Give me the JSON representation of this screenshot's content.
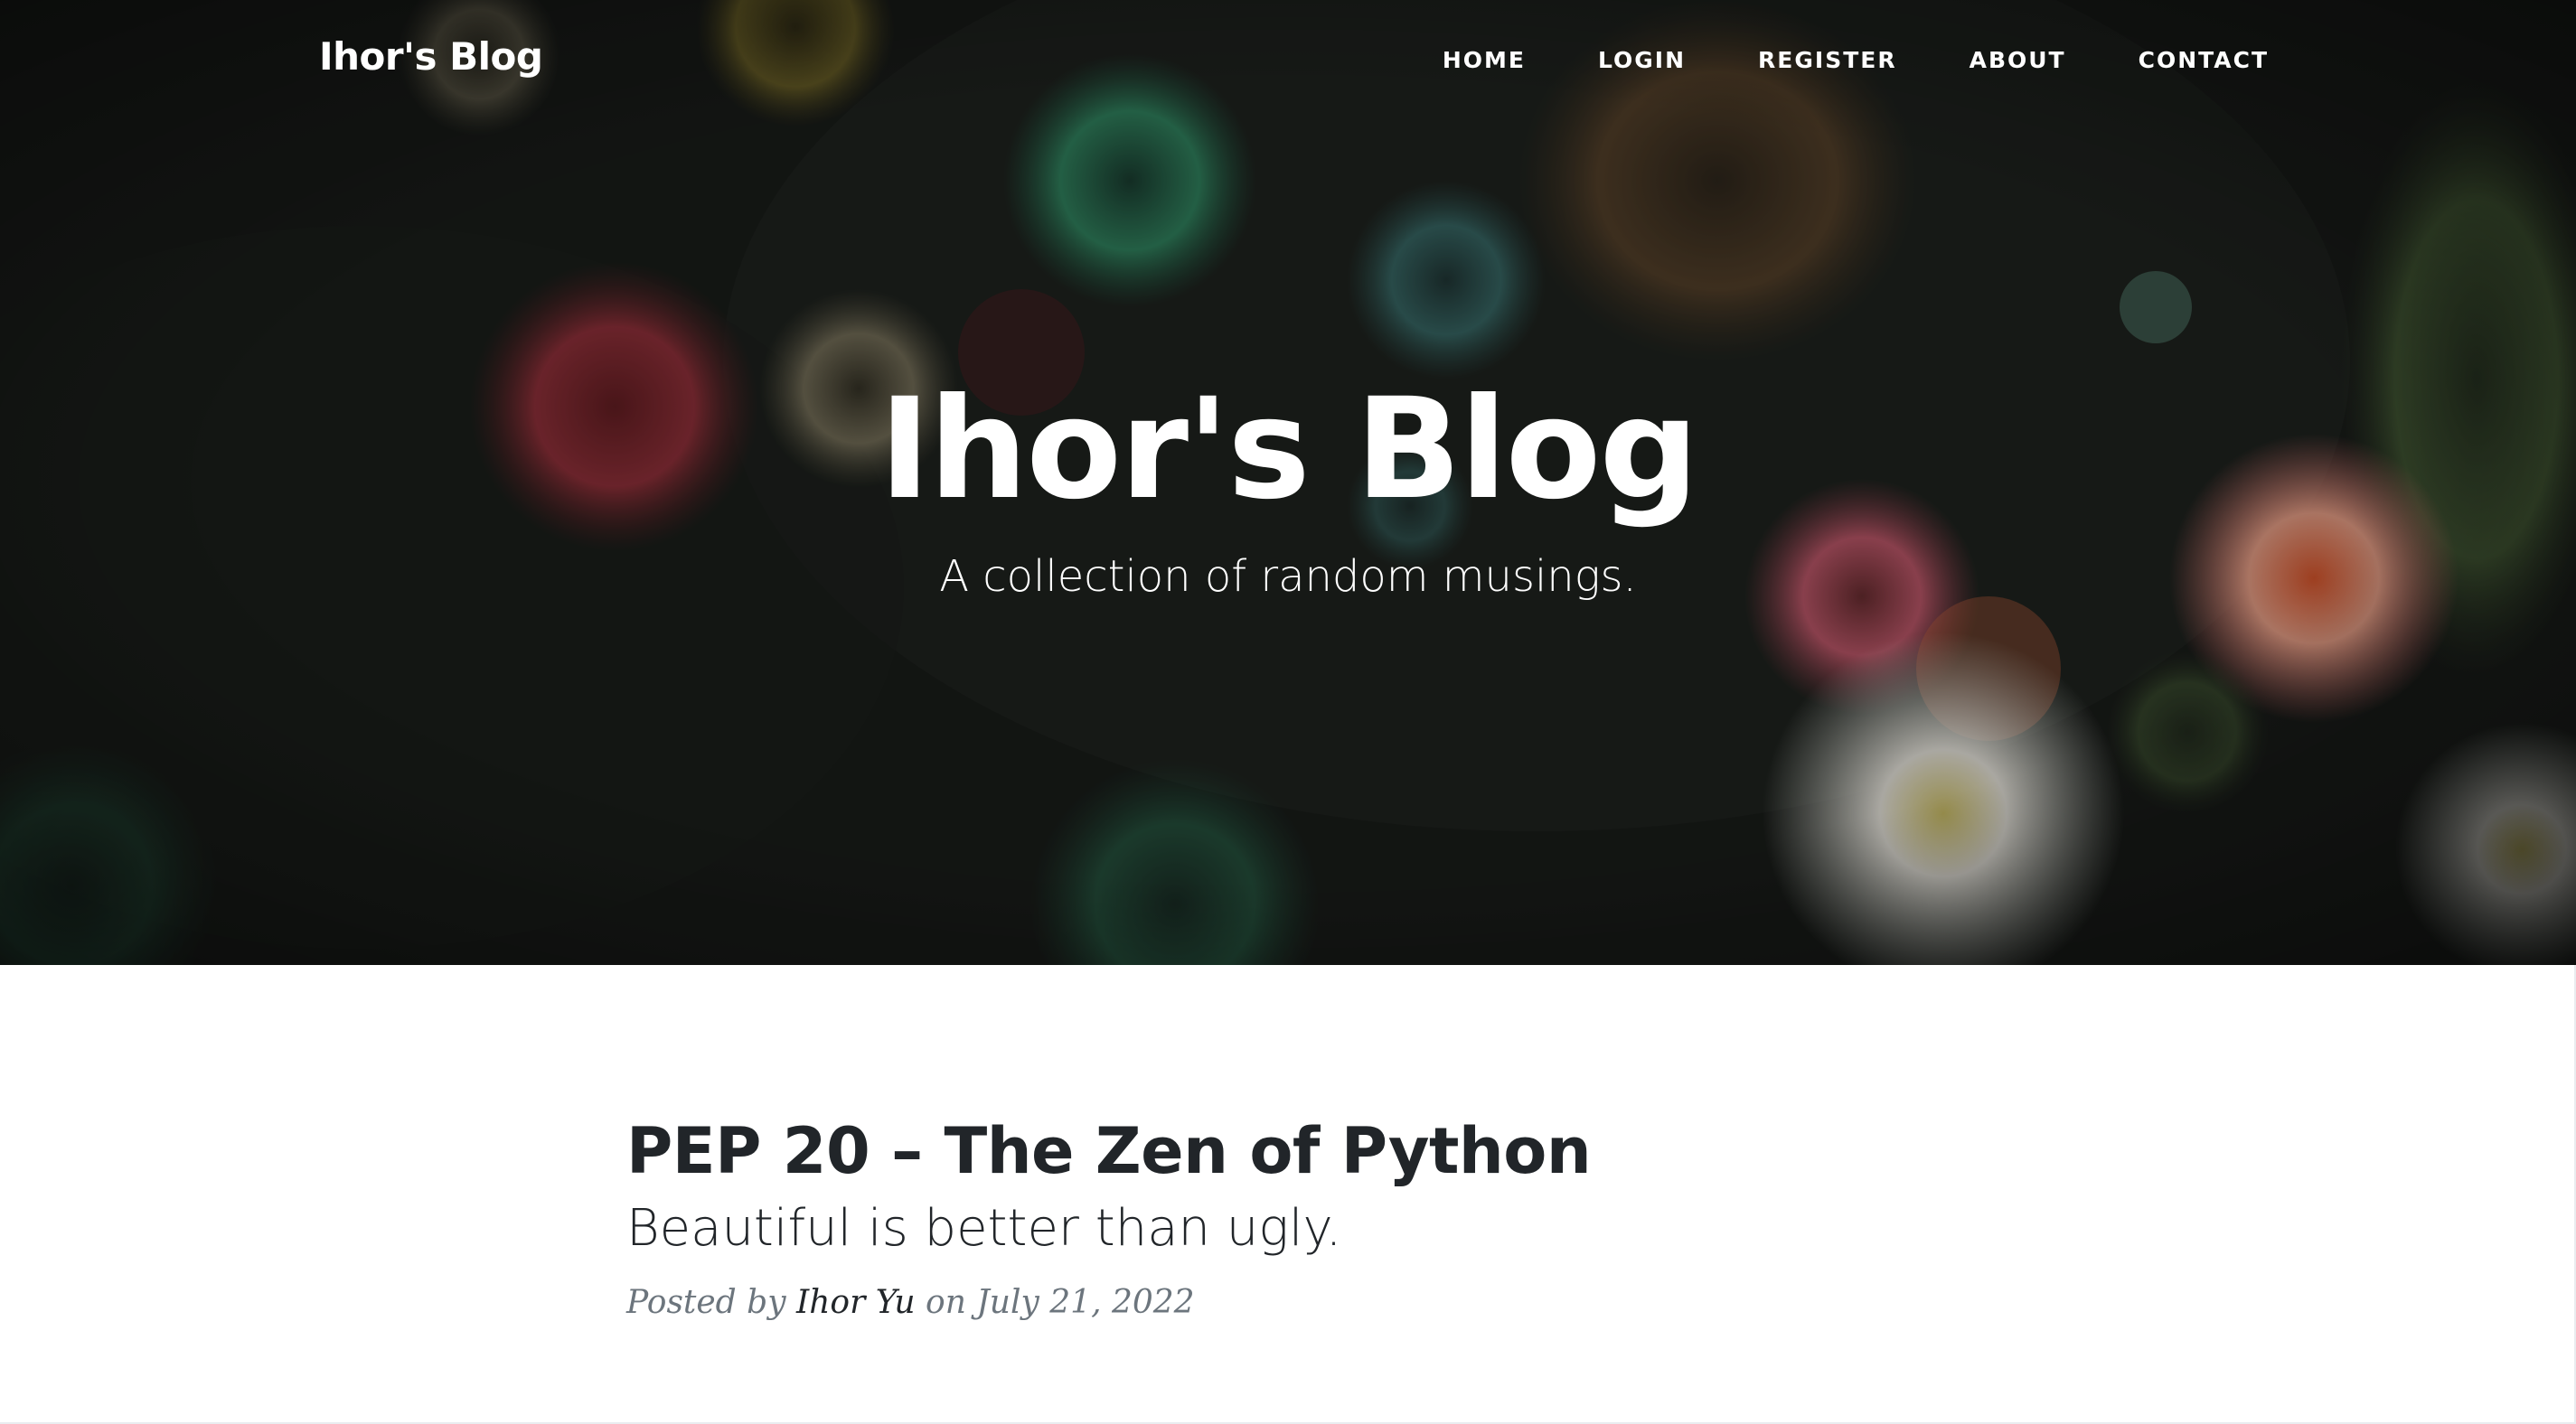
{
  "colors": {
    "hero_background": "#141614",
    "text_white": "#ffffff",
    "heading_dark": "#212529",
    "meta_gray": "#6c757d"
  },
  "navbar": {
    "brand": "Ihor's Blog",
    "links": [
      {
        "label": "HOME"
      },
      {
        "label": "LOGIN"
      },
      {
        "label": "REGISTER"
      },
      {
        "label": "ABOUT"
      },
      {
        "label": "CONTACT"
      }
    ]
  },
  "hero": {
    "heading": "Ihor's Blog",
    "subheading": "A collection of random musings."
  },
  "posts": [
    {
      "title": "PEP 20 – The Zen of Python",
      "subtitle": "Beautiful is better than ugly.",
      "meta_prefix": "Posted by",
      "author": "Ihor Yu",
      "meta_on": "on",
      "date": "July 21, 2022"
    }
  ]
}
